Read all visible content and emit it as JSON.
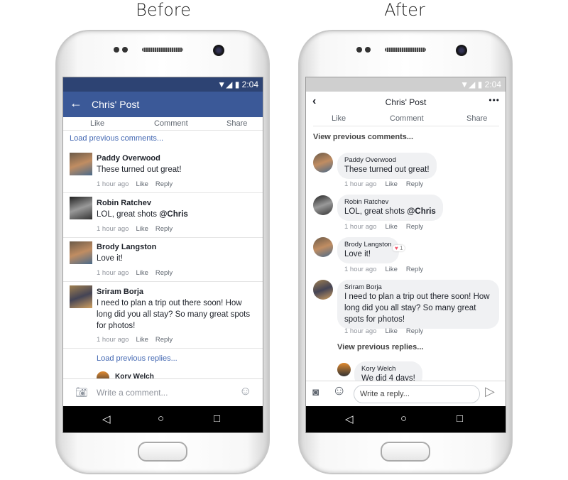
{
  "captions": {
    "before": "Before",
    "after": "After"
  },
  "status": {
    "time": "2:04"
  },
  "before": {
    "title": "Chris' Post",
    "actions": [
      "Like",
      "Comment",
      "Share"
    ],
    "load_comments": "Load previous comments...",
    "comments": [
      {
        "name": "Paddy Overwood",
        "text": "These turned out great!",
        "time": "1 hour ago",
        "like": "Like",
        "reply": "Reply"
      },
      {
        "name": "Robin Ratchev",
        "text": "LOL, great shots ",
        "mention": "@Chris",
        "time": "1 hour ago",
        "like": "Like",
        "reply": "Reply"
      },
      {
        "name": "Brody Langston",
        "text": "Love it!",
        "time": "1 hour ago",
        "like": "Like",
        "reply": "Reply"
      },
      {
        "name": "Sriram Borja",
        "text": "I need to plan a trip out there soon! How long did you all stay? So many great spots for photos!",
        "time": "1 hour ago",
        "like": "Like",
        "reply": "Reply"
      }
    ],
    "load_replies": "Load previous replies...",
    "reply_name": "Kory Welch",
    "input_placeholder": "Write a comment..."
  },
  "after": {
    "title": "Chris' Post",
    "actions": [
      "Like",
      "Comment",
      "Share"
    ],
    "view_comments": "View previous comments...",
    "comments": [
      {
        "name": "Paddy Overwood",
        "text": "These turned out great!",
        "time": "1 hour ago",
        "like": "Like",
        "reply": "Reply"
      },
      {
        "name": "Robin Ratchev",
        "text": "LOL, great shots ",
        "mention": "@Chris",
        "time": "1 hour ago",
        "like": "Like",
        "reply": "Reply"
      },
      {
        "name": "Brody Langston",
        "text": "Love it!",
        "time": "1 hour ago",
        "like": "Like",
        "reply": "Reply",
        "reaction_count": "1"
      },
      {
        "name": "Sriram Borja",
        "text": "I need to plan a trip out there soon! How long did you all stay? So many great spots for photos!",
        "time": "1 hour ago",
        "like": "Like",
        "reply": "Reply"
      }
    ],
    "view_replies": "View previous replies...",
    "reply": {
      "name": "Kory Welch",
      "text": "We did 4 days!"
    },
    "input_placeholder": "Write a reply..."
  },
  "colors": {
    "fb_blue": "#3b5998",
    "status_dark": "#2d4373",
    "link": "#4267b2",
    "bubble": "#f0f1f3"
  }
}
